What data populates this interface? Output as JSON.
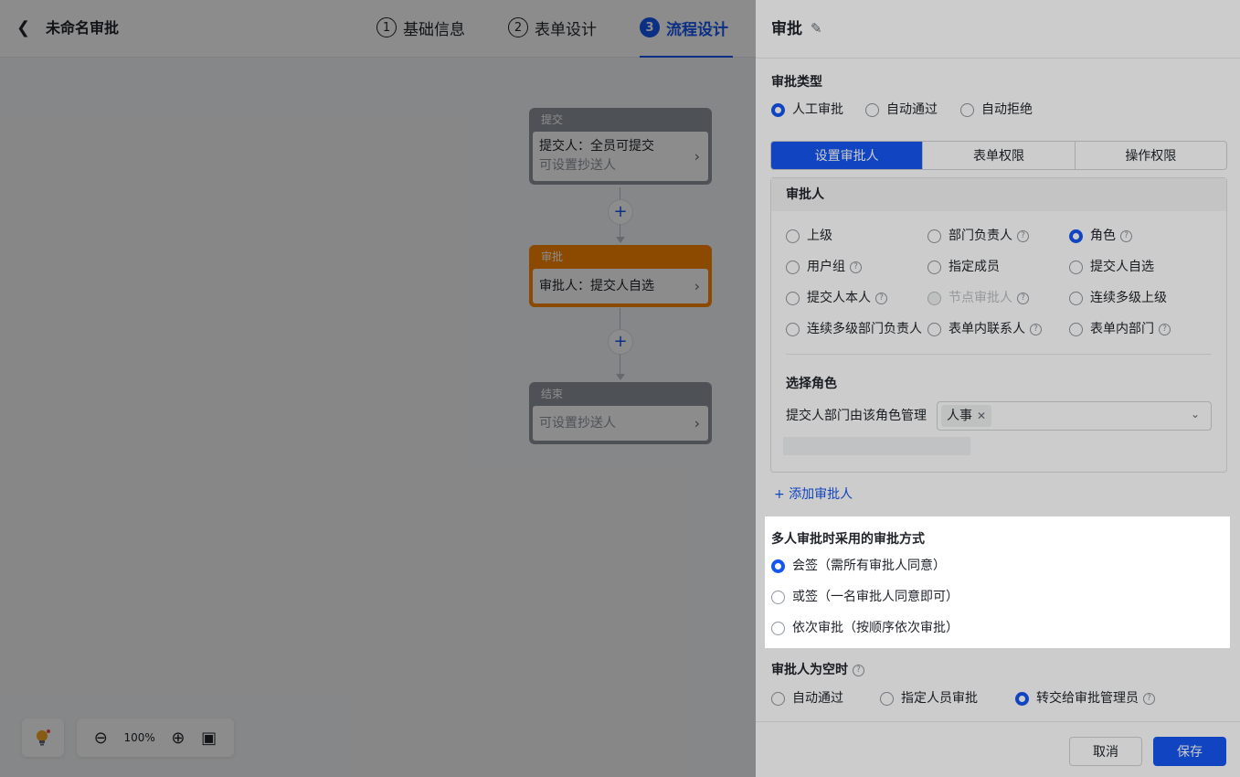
{
  "header": {
    "back_icon": "chevron-left-icon",
    "title": "未命名审批",
    "steps": [
      {
        "num": "1",
        "label": "基础信息"
      },
      {
        "num": "2",
        "label": "表单设计"
      },
      {
        "num": "3",
        "label": "流程设计"
      }
    ]
  },
  "flow": {
    "submit": {
      "head": "提交",
      "line1": "提交人：全员可提交",
      "line2": "可设置抄送人"
    },
    "approve": {
      "head": "审批",
      "line1": "审批人：提交人自选"
    },
    "end": {
      "head": "结束",
      "line1": "可设置抄送人"
    },
    "plus": "+"
  },
  "toolbar": {
    "bulb_icon": "lightbulb-icon",
    "zoom": "100%"
  },
  "drawer": {
    "title": "审批",
    "approval_type": {
      "label": "审批类型",
      "options": [
        "人工审批",
        "自动通过",
        "自动拒绝"
      ],
      "selected": 0
    },
    "tabs": [
      "设置审批人",
      "表单权限",
      "操作权限"
    ],
    "approver_panel": {
      "label": "审批人",
      "options": [
        "上级",
        "部门负责人",
        "角色",
        "用户组",
        "指定成员",
        "提交人自选",
        "提交人本人",
        "节点审批人",
        "连续多级上级",
        "连续多级部门负责人",
        "表单内联系人",
        "表单内部门"
      ]
    },
    "role": {
      "label": "选择角色",
      "field_label": "提交人部门由该角色管理",
      "tag": "人事",
      "tag_close": "✕"
    },
    "add_approver": "添加审批人",
    "multi_mode": {
      "label": "多人审批时采用的审批方式",
      "options": [
        "会签（需所有审批人同意）",
        "或签（一名审批人同意即可）",
        "依次审批（按顺序依次审批）"
      ]
    },
    "empty_approver": {
      "label": "审批人为空时",
      "options": [
        "自动通过",
        "指定人员审批",
        "转交给审批管理员"
      ]
    },
    "cancel": "取消",
    "save": "保存"
  },
  "colors": {
    "accent": "#1456f0",
    "approve_node": "#ff8800",
    "neutral_node": "#8f959e"
  }
}
